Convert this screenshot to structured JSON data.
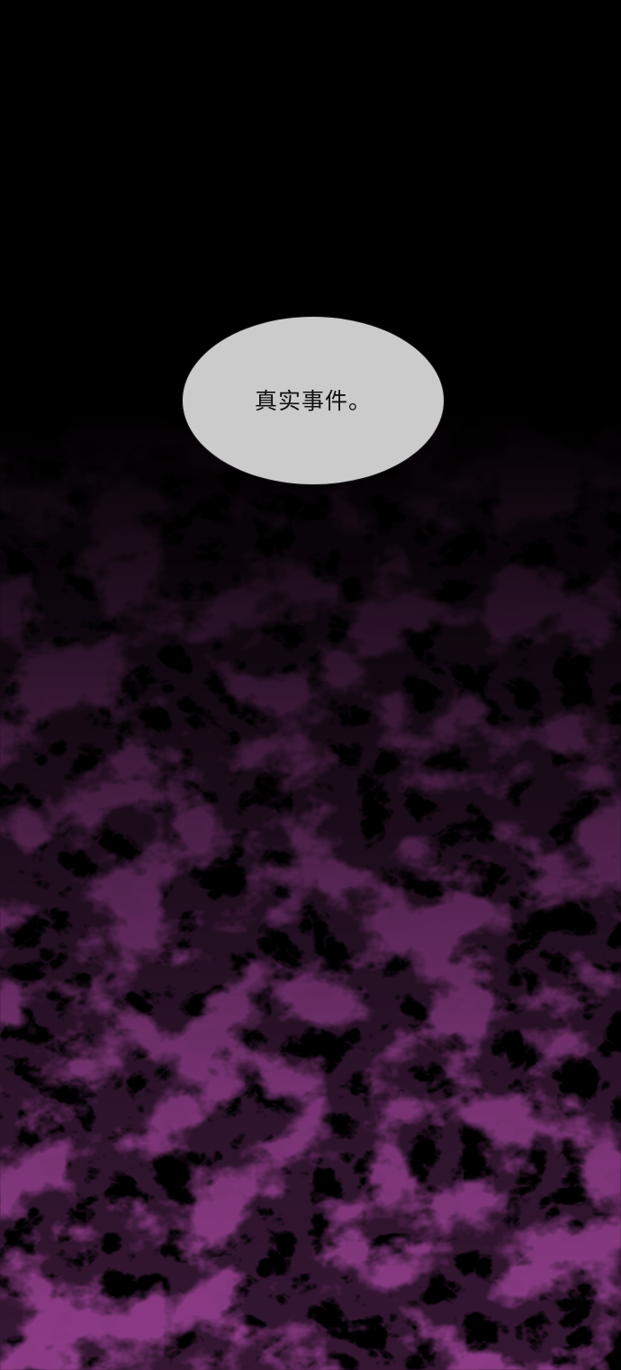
{
  "speech_bubble": {
    "text": "真实事件。"
  },
  "colors": {
    "background": "#000000",
    "smoke_tint": "#5a1052",
    "bubble_fill": "#cbcbcb",
    "bubble_outline": "#1c1c1c",
    "text": "#111111"
  }
}
